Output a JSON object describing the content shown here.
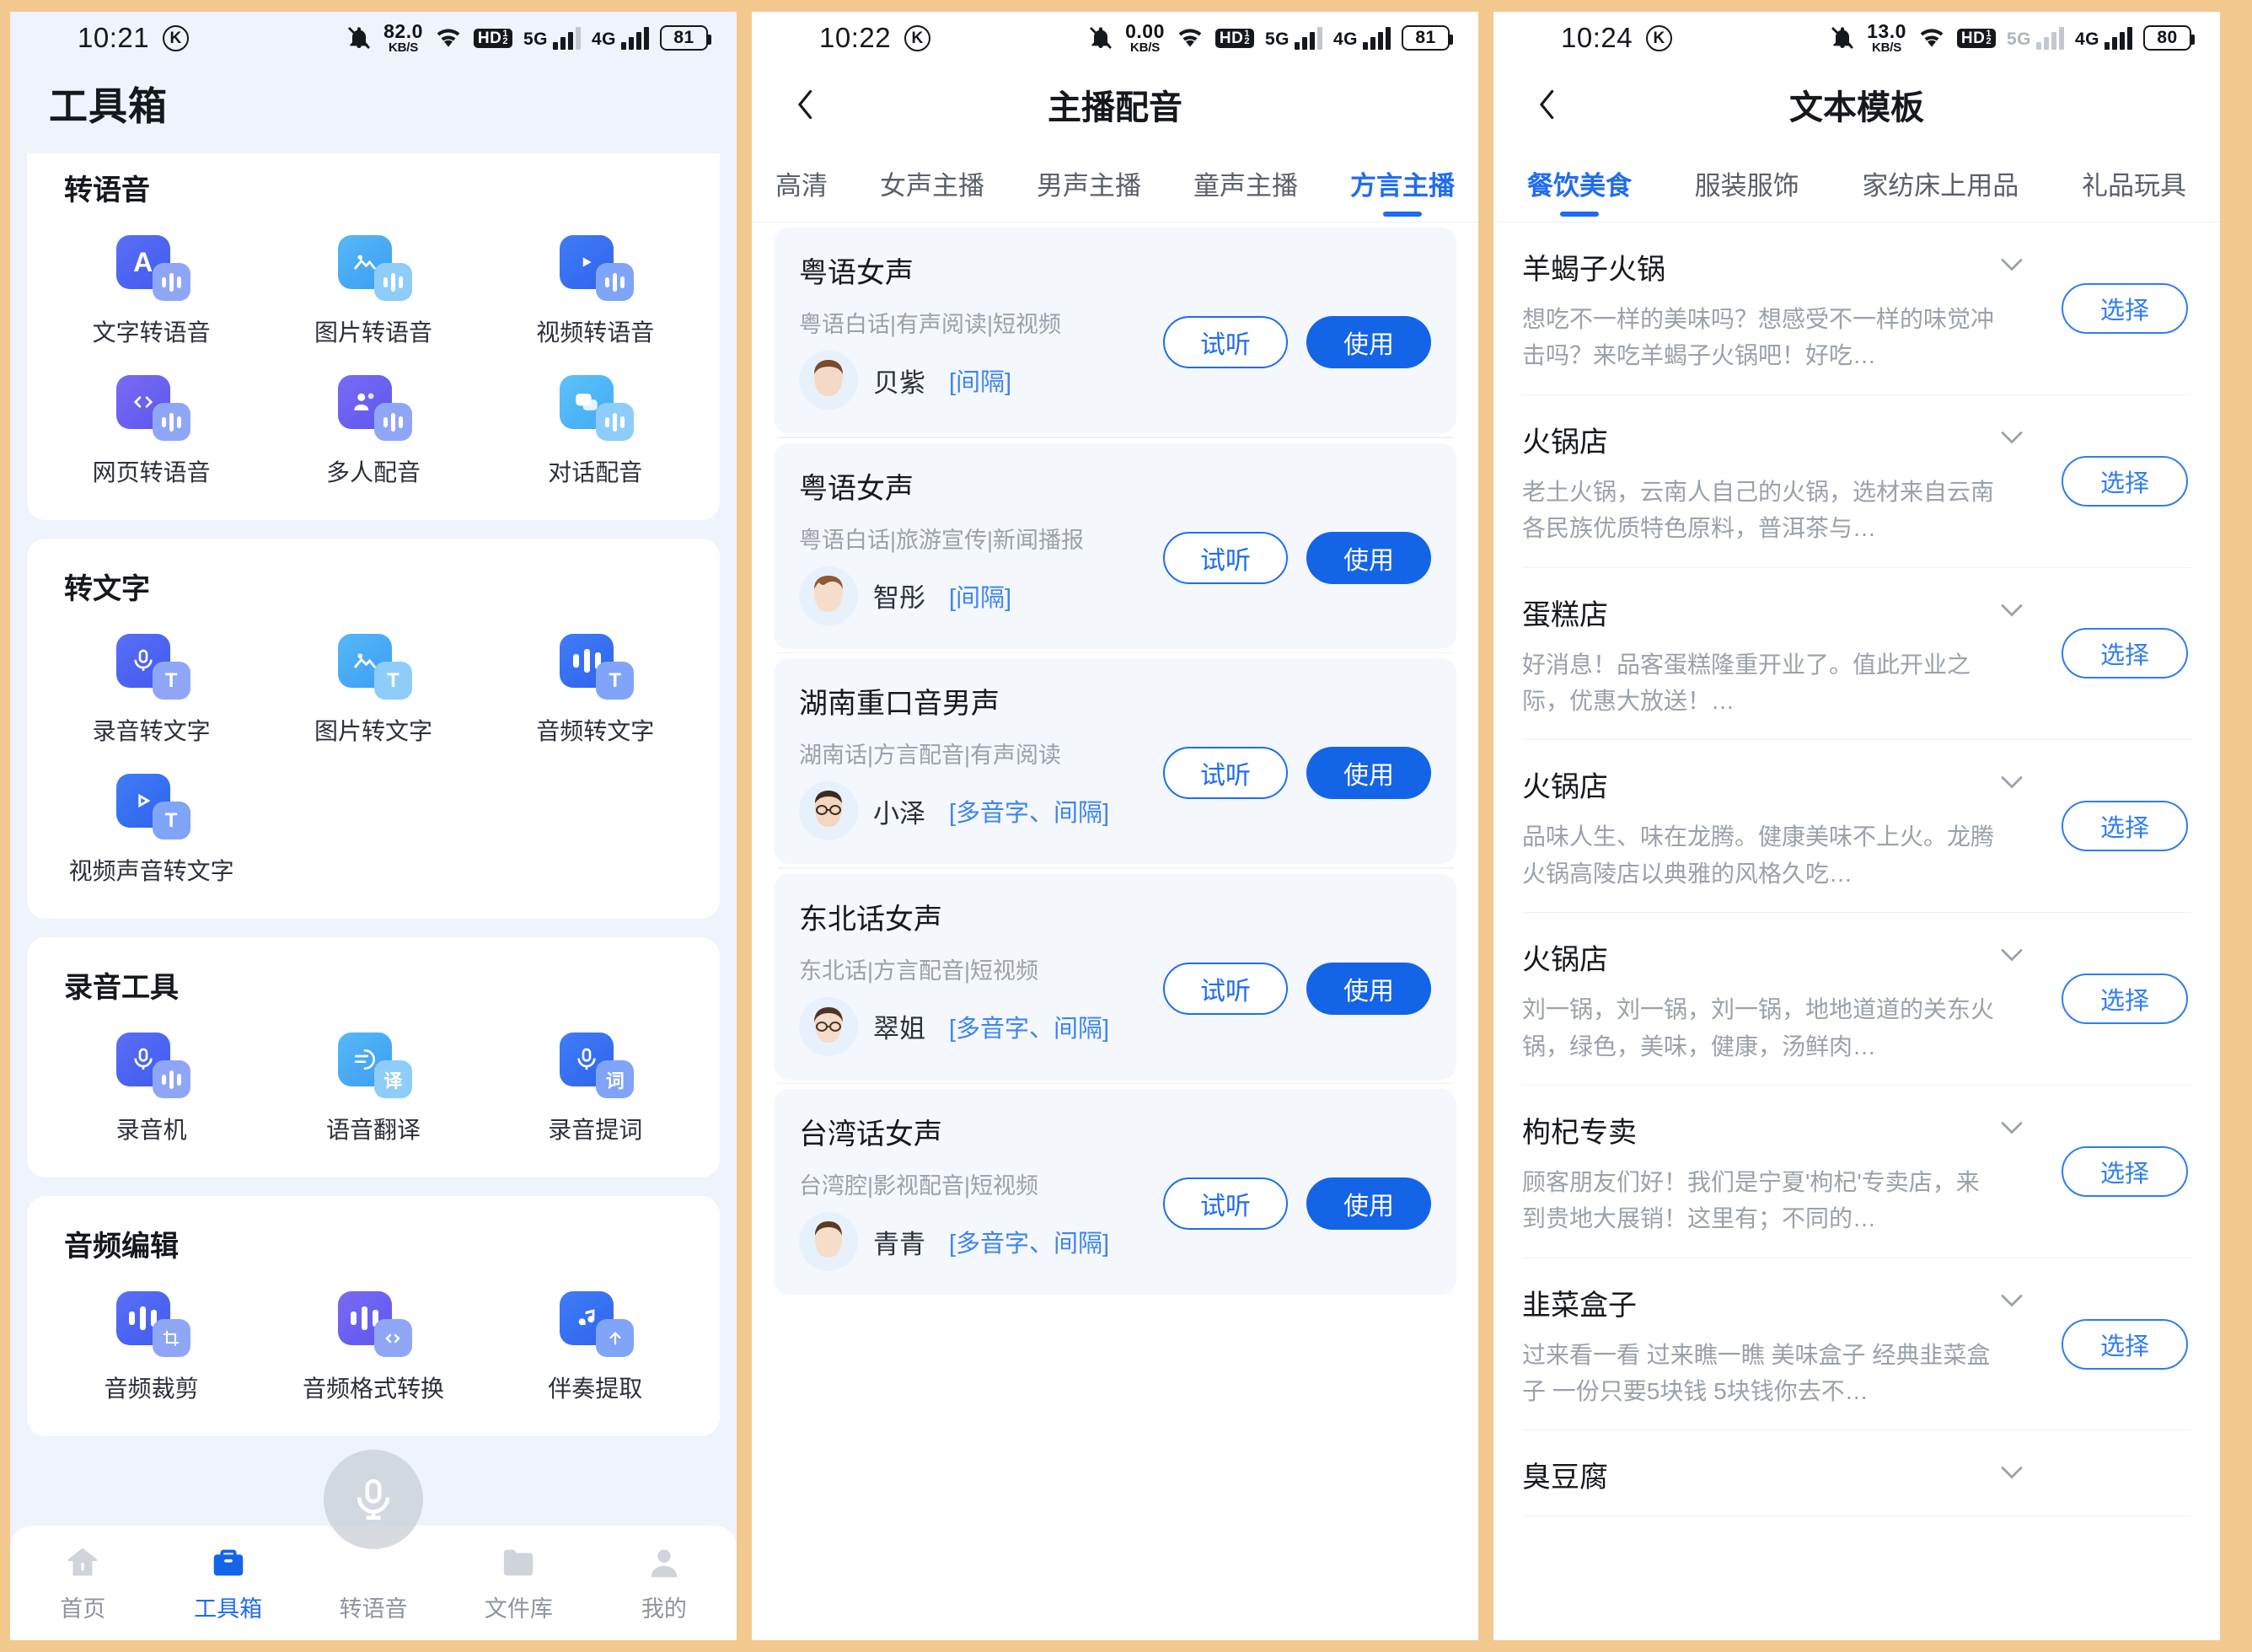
{
  "colors": {
    "accent": "#1f6cf0",
    "accent_dark": "#1464e8",
    "muted": "#9aa1aa",
    "panel_bg": "#eef3fc"
  },
  "panel1": {
    "status": {
      "time": "10:21",
      "k_badge": "K",
      "net_value": "82.0",
      "net_unit": "KB/S",
      "hd": "HD",
      "hd_sup": "1",
      "hd_sub": "2",
      "net5g": "5G",
      "net4g": "4G",
      "battery": "81"
    },
    "title": "工具箱",
    "sections": [
      {
        "name": "转语音",
        "tools": [
          {
            "label": "文字转语音",
            "icon": "text-to-speech-icon"
          },
          {
            "label": "图片转语音",
            "icon": "image-to-speech-icon"
          },
          {
            "label": "视频转语音",
            "icon": "video-to-speech-icon"
          },
          {
            "label": "网页转语音",
            "icon": "webpage-to-speech-icon"
          },
          {
            "label": "多人配音",
            "icon": "multi-speaker-dubbing-icon"
          },
          {
            "label": "对话配音",
            "icon": "dialogue-dubbing-icon"
          }
        ]
      },
      {
        "name": "转文字",
        "tools": [
          {
            "label": "录音转文字",
            "icon": "recording-to-text-icon"
          },
          {
            "label": "图片转文字",
            "icon": "image-to-text-icon"
          },
          {
            "label": "音频转文字",
            "icon": "audio-to-text-icon"
          },
          {
            "label": "视频声音转文字",
            "icon": "video-audio-to-text-icon"
          }
        ]
      },
      {
        "name": "录音工具",
        "tools": [
          {
            "label": "录音机",
            "icon": "recorder-icon"
          },
          {
            "label": "语音翻译",
            "icon": "voice-translate-icon"
          },
          {
            "label": "录音提词",
            "icon": "recording-prompter-icon"
          }
        ]
      },
      {
        "name": "音频编辑",
        "tools": [
          {
            "label": "音频裁剪",
            "icon": "audio-trim-icon"
          },
          {
            "label": "音频格式转换",
            "icon": "audio-format-convert-icon"
          },
          {
            "label": "伴奏提取",
            "icon": "accompaniment-extract-icon"
          }
        ]
      }
    ],
    "fab": "mic-fab",
    "tabbar": [
      {
        "label": "首页",
        "icon": "home-icon",
        "active": false
      },
      {
        "label": "工具箱",
        "icon": "toolbox-icon",
        "active": true
      },
      {
        "label": "转语音",
        "icon": "to-speech-icon",
        "active": false
      },
      {
        "label": "文件库",
        "icon": "files-icon",
        "active": false
      },
      {
        "label": "我的",
        "icon": "profile-icon",
        "active": false
      }
    ]
  },
  "panel2": {
    "status": {
      "time": "10:22",
      "k_badge": "K",
      "net_value": "0.00",
      "net_unit": "KB/S",
      "hd": "HD",
      "hd_sup": "1",
      "hd_sub": "2",
      "net5g": "5G",
      "net4g": "4G",
      "battery": "81"
    },
    "nav_title": "主播配音",
    "tabs": [
      {
        "label": "高清",
        "active": false
      },
      {
        "label": "女声主播",
        "active": false
      },
      {
        "label": "男声主播",
        "active": false
      },
      {
        "label": "童声主播",
        "active": false
      },
      {
        "label": "方言主播",
        "active": true
      }
    ],
    "btn_try": "试听",
    "btn_use": "使用",
    "voices": [
      {
        "name": "粤语女声",
        "meta": "粤语白话|有声阅读|短视频",
        "speaker": "贝紫",
        "tags": "[间隔]",
        "avatar": "female-1"
      },
      {
        "name": "粤语女声",
        "meta": "粤语白话|旅游宣传|新闻播报",
        "speaker": "智彤",
        "tags": "[间隔]",
        "avatar": "female-2"
      },
      {
        "name": "湖南重口音男声",
        "meta": "湖南话|方言配音|有声阅读",
        "speaker": "小泽",
        "tags": "[多音字、间隔]",
        "avatar": "male-1"
      },
      {
        "name": "东北话女声",
        "meta": "东北话|方言配音|短视频",
        "speaker": "翠姐",
        "tags": "[多音字、间隔]",
        "avatar": "female-3"
      },
      {
        "name": "台湾话女声",
        "meta": "台湾腔|影视配音|短视频",
        "speaker": "青青",
        "tags": "[多音字、间隔]",
        "avatar": "female-4"
      }
    ]
  },
  "panel3": {
    "status": {
      "time": "10:24",
      "k_badge": "K",
      "net_value": "13.0",
      "net_unit": "KB/S",
      "hd": "HD",
      "hd_sup": "1",
      "hd_sub": "2",
      "net5g": "5G",
      "net4g": "4G",
      "battery": "80"
    },
    "nav_title": "文本模板",
    "tabs": [
      {
        "label": "餐饮美食",
        "active": true
      },
      {
        "label": "服装服饰",
        "active": false
      },
      {
        "label": "家纺床上用品",
        "active": false
      },
      {
        "label": "礼品玩具",
        "active": false
      }
    ],
    "btn_select": "选择",
    "templates": [
      {
        "title": "羊蝎子火锅",
        "desc": "想吃不一样的美味吗？想感受不一样的味觉冲击吗？来吃羊蝎子火锅吧！好吃…"
      },
      {
        "title": "火锅店",
        "desc": "老土火锅，云南人自己的火锅，选材来自云南各民族优质特色原料，普洱茶与…"
      },
      {
        "title": "蛋糕店",
        "desc": "好消息！品客蛋糕隆重开业了。值此开业之际，优惠大放送！…"
      },
      {
        "title": "火锅店",
        "desc": "品味人生、味在龙腾。健康美味不上火。龙腾火锅高陵店以典雅的风格久吃…"
      },
      {
        "title": "火锅店",
        "desc": "刘一锅，刘一锅，刘一锅，地地道道的关东火锅，绿色，美味，健康，汤鲜肉…"
      },
      {
        "title": "枸杞专卖",
        "desc": "顾客朋友们好！我们是宁夏'枸杞'专卖店，来到贵地大展销！这里有；不同的…"
      },
      {
        "title": "韭菜盒子",
        "desc": "过来看一看 过来瞧一瞧 美味盒子 经典韭菜盒子 一份只要5块钱 5块钱你去不…"
      },
      {
        "title": "臭豆腐",
        "desc": ""
      }
    ]
  }
}
